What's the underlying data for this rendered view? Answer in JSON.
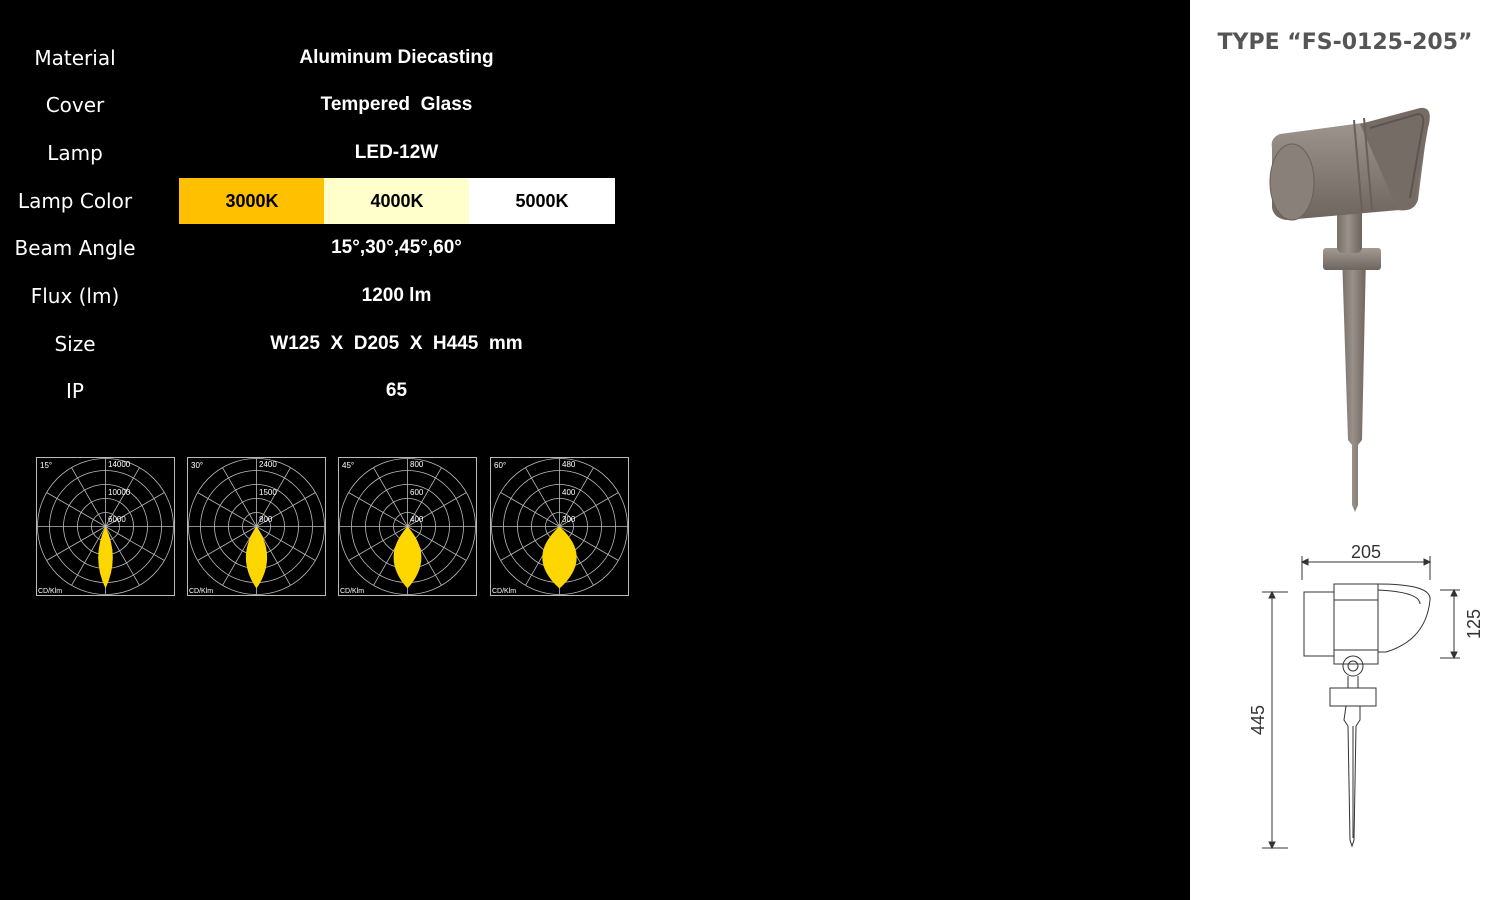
{
  "specs": [
    {
      "label": "Material",
      "value": "Aluminum Diecasting"
    },
    {
      "label": "Cover",
      "value": "Tempered  Glass"
    },
    {
      "label": "Lamp",
      "value": "LED-12W"
    },
    {
      "label": "Lamp Color",
      "value": ""
    },
    {
      "label": "Beam Angle",
      "value": "15°,30°,45°,60°"
    },
    {
      "label": "Flux (lm)",
      "value": "1200 lm"
    },
    {
      "label": "Size",
      "value": "W125  X  D205  X  H445  mm"
    },
    {
      "label": "IP",
      "value": "65"
    }
  ],
  "lamp_colors": [
    {
      "label": "3000K",
      "color": "#ffc000"
    },
    {
      "label": "4000K",
      "color": "#ffffcc"
    },
    {
      "label": "5000K",
      "color": "#ffffff"
    }
  ],
  "polar_charts": [
    {
      "angle": "15°",
      "rings": [
        "14000",
        "10000",
        "6000"
      ],
      "unit": "CD/Klm",
      "beam_deg": 15
    },
    {
      "angle": "30°",
      "rings": [
        "2400",
        "1500",
        "800"
      ],
      "unit": "CD/Klm",
      "beam_deg": 30
    },
    {
      "angle": "45°",
      "rings": [
        "800",
        "600",
        "400"
      ],
      "unit": "CD/Klm",
      "beam_deg": 45
    },
    {
      "angle": "60°",
      "rings": [
        "480",
        "400",
        "300"
      ],
      "unit": "CD/Klm",
      "beam_deg": 60
    }
  ],
  "product": {
    "type_title": "TYPE “FS-0125-205”",
    "dim_width": "205",
    "dim_head_height": "125",
    "dim_total_height": "445"
  },
  "colors": {
    "beam": "#ffd700",
    "product_body": "#8a7f78"
  }
}
